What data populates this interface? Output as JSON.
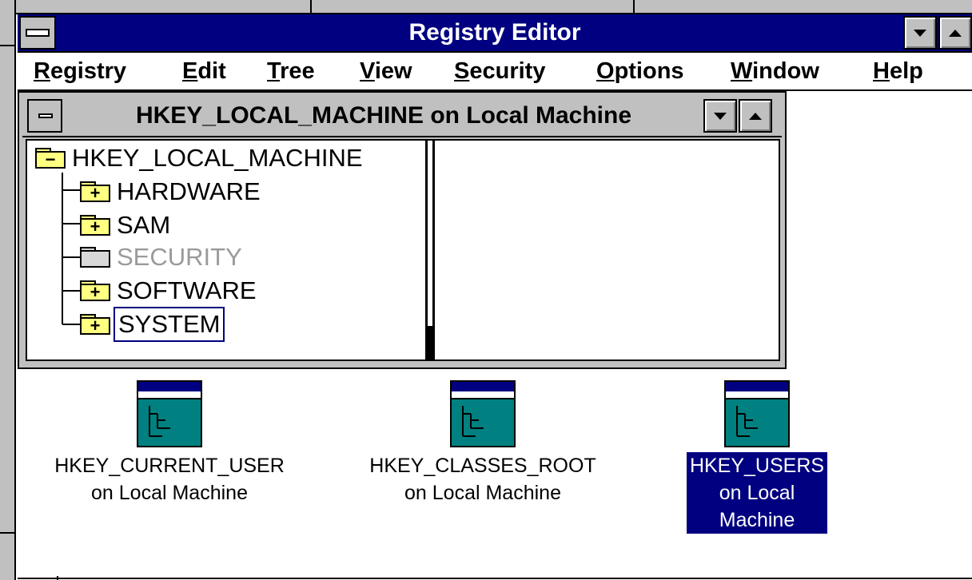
{
  "app": {
    "title": "Registry Editor"
  },
  "menubar": {
    "items": [
      {
        "acc": "R",
        "rest": "egistry"
      },
      {
        "acc": "E",
        "rest": "dit"
      },
      {
        "acc": "T",
        "rest": "ree"
      },
      {
        "acc": "V",
        "rest": "iew"
      },
      {
        "acc": "S",
        "rest": "ecurity"
      },
      {
        "acc": "O",
        "rest": "ptions"
      },
      {
        "acc": "W",
        "rest": "indow"
      },
      {
        "acc": "H",
        "rest": "elp"
      }
    ]
  },
  "child_window": {
    "title": "HKEY_LOCAL_MACHINE on Local Machine",
    "tree": {
      "root": {
        "label": "HKEY_LOCAL_MACHINE",
        "icon": "open-folder-minus-icon"
      },
      "children": [
        {
          "label": "HARDWARE",
          "icon": "folder-plus-icon",
          "state": "normal"
        },
        {
          "label": "SAM",
          "icon": "folder-plus-icon",
          "state": "normal"
        },
        {
          "label": "SECURITY",
          "icon": "folder-grey-icon",
          "state": "disabled"
        },
        {
          "label": "SOFTWARE",
          "icon": "folder-plus-icon",
          "state": "normal"
        },
        {
          "label": "SYSTEM",
          "icon": "folder-open-plus-icon",
          "state": "selected"
        }
      ]
    }
  },
  "minimized_windows": [
    {
      "line1": "HKEY_CURRENT_USER",
      "line2": "on Local Machine",
      "selected": false
    },
    {
      "line1": "HKEY_CLASSES_ROOT",
      "line2": "on Local Machine",
      "selected": false
    },
    {
      "line1": "HKEY_USERS",
      "line2": "on Local",
      "line3": "Machine",
      "selected": true
    }
  ],
  "colors": {
    "titlebar": "#000080",
    "face": "#c0c0c0",
    "folder": "#ffff80",
    "icon_teal": "#008080",
    "selection": "#000080"
  }
}
